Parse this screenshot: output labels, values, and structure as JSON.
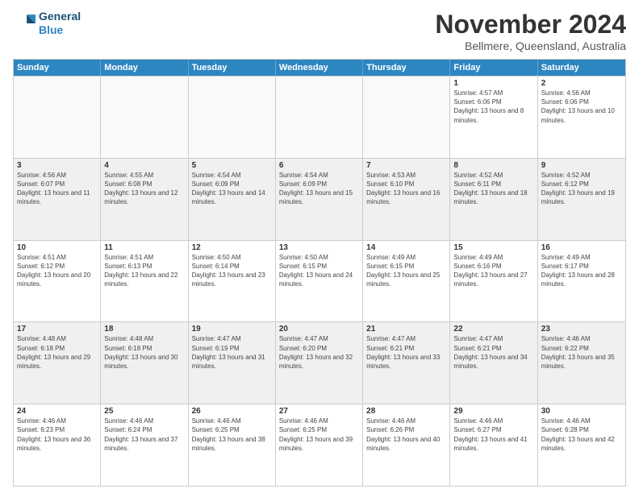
{
  "header": {
    "logo_line1": "General",
    "logo_line2": "Blue",
    "title": "November 2024",
    "subtitle": "Bellmere, Queensland, Australia"
  },
  "calendar": {
    "days_of_week": [
      "Sunday",
      "Monday",
      "Tuesday",
      "Wednesday",
      "Thursday",
      "Friday",
      "Saturday"
    ],
    "weeks": [
      [
        {
          "day": "",
          "empty": true
        },
        {
          "day": "",
          "empty": true
        },
        {
          "day": "",
          "empty": true
        },
        {
          "day": "",
          "empty": true
        },
        {
          "day": "",
          "empty": true
        },
        {
          "day": "1",
          "info": "Sunrise: 4:57 AM\nSunset: 6:06 PM\nDaylight: 13 hours and 8 minutes."
        },
        {
          "day": "2",
          "info": "Sunrise: 4:56 AM\nSunset: 6:06 PM\nDaylight: 13 hours and 10 minutes."
        }
      ],
      [
        {
          "day": "3",
          "info": "Sunrise: 4:56 AM\nSunset: 6:07 PM\nDaylight: 13 hours and 11 minutes."
        },
        {
          "day": "4",
          "info": "Sunrise: 4:55 AM\nSunset: 6:08 PM\nDaylight: 13 hours and 12 minutes."
        },
        {
          "day": "5",
          "info": "Sunrise: 4:54 AM\nSunset: 6:09 PM\nDaylight: 13 hours and 14 minutes."
        },
        {
          "day": "6",
          "info": "Sunrise: 4:54 AM\nSunset: 6:09 PM\nDaylight: 13 hours and 15 minutes."
        },
        {
          "day": "7",
          "info": "Sunrise: 4:53 AM\nSunset: 6:10 PM\nDaylight: 13 hours and 16 minutes."
        },
        {
          "day": "8",
          "info": "Sunrise: 4:52 AM\nSunset: 6:11 PM\nDaylight: 13 hours and 18 minutes."
        },
        {
          "day": "9",
          "info": "Sunrise: 4:52 AM\nSunset: 6:12 PM\nDaylight: 13 hours and 19 minutes."
        }
      ],
      [
        {
          "day": "10",
          "info": "Sunrise: 4:51 AM\nSunset: 6:12 PM\nDaylight: 13 hours and 20 minutes."
        },
        {
          "day": "11",
          "info": "Sunrise: 4:51 AM\nSunset: 6:13 PM\nDaylight: 13 hours and 22 minutes."
        },
        {
          "day": "12",
          "info": "Sunrise: 4:50 AM\nSunset: 6:14 PM\nDaylight: 13 hours and 23 minutes."
        },
        {
          "day": "13",
          "info": "Sunrise: 4:50 AM\nSunset: 6:15 PM\nDaylight: 13 hours and 24 minutes."
        },
        {
          "day": "14",
          "info": "Sunrise: 4:49 AM\nSunset: 6:15 PM\nDaylight: 13 hours and 25 minutes."
        },
        {
          "day": "15",
          "info": "Sunrise: 4:49 AM\nSunset: 6:16 PM\nDaylight: 13 hours and 27 minutes."
        },
        {
          "day": "16",
          "info": "Sunrise: 4:49 AM\nSunset: 6:17 PM\nDaylight: 13 hours and 28 minutes."
        }
      ],
      [
        {
          "day": "17",
          "info": "Sunrise: 4:48 AM\nSunset: 6:18 PM\nDaylight: 13 hours and 29 minutes."
        },
        {
          "day": "18",
          "info": "Sunrise: 4:48 AM\nSunset: 6:18 PM\nDaylight: 13 hours and 30 minutes."
        },
        {
          "day": "19",
          "info": "Sunrise: 4:47 AM\nSunset: 6:19 PM\nDaylight: 13 hours and 31 minutes."
        },
        {
          "day": "20",
          "info": "Sunrise: 4:47 AM\nSunset: 6:20 PM\nDaylight: 13 hours and 32 minutes."
        },
        {
          "day": "21",
          "info": "Sunrise: 4:47 AM\nSunset: 6:21 PM\nDaylight: 13 hours and 33 minutes."
        },
        {
          "day": "22",
          "info": "Sunrise: 4:47 AM\nSunset: 6:21 PM\nDaylight: 13 hours and 34 minutes."
        },
        {
          "day": "23",
          "info": "Sunrise: 4:46 AM\nSunset: 6:22 PM\nDaylight: 13 hours and 35 minutes."
        }
      ],
      [
        {
          "day": "24",
          "info": "Sunrise: 4:46 AM\nSunset: 6:23 PM\nDaylight: 13 hours and 36 minutes."
        },
        {
          "day": "25",
          "info": "Sunrise: 4:46 AM\nSunset: 6:24 PM\nDaylight: 13 hours and 37 minutes."
        },
        {
          "day": "26",
          "info": "Sunrise: 4:46 AM\nSunset: 6:25 PM\nDaylight: 13 hours and 38 minutes."
        },
        {
          "day": "27",
          "info": "Sunrise: 4:46 AM\nSunset: 6:25 PM\nDaylight: 13 hours and 39 minutes."
        },
        {
          "day": "28",
          "info": "Sunrise: 4:46 AM\nSunset: 6:26 PM\nDaylight: 13 hours and 40 minutes."
        },
        {
          "day": "29",
          "info": "Sunrise: 4:46 AM\nSunset: 6:27 PM\nDaylight: 13 hours and 41 minutes."
        },
        {
          "day": "30",
          "info": "Sunrise: 4:46 AM\nSunset: 6:28 PM\nDaylight: 13 hours and 42 minutes."
        }
      ]
    ]
  }
}
